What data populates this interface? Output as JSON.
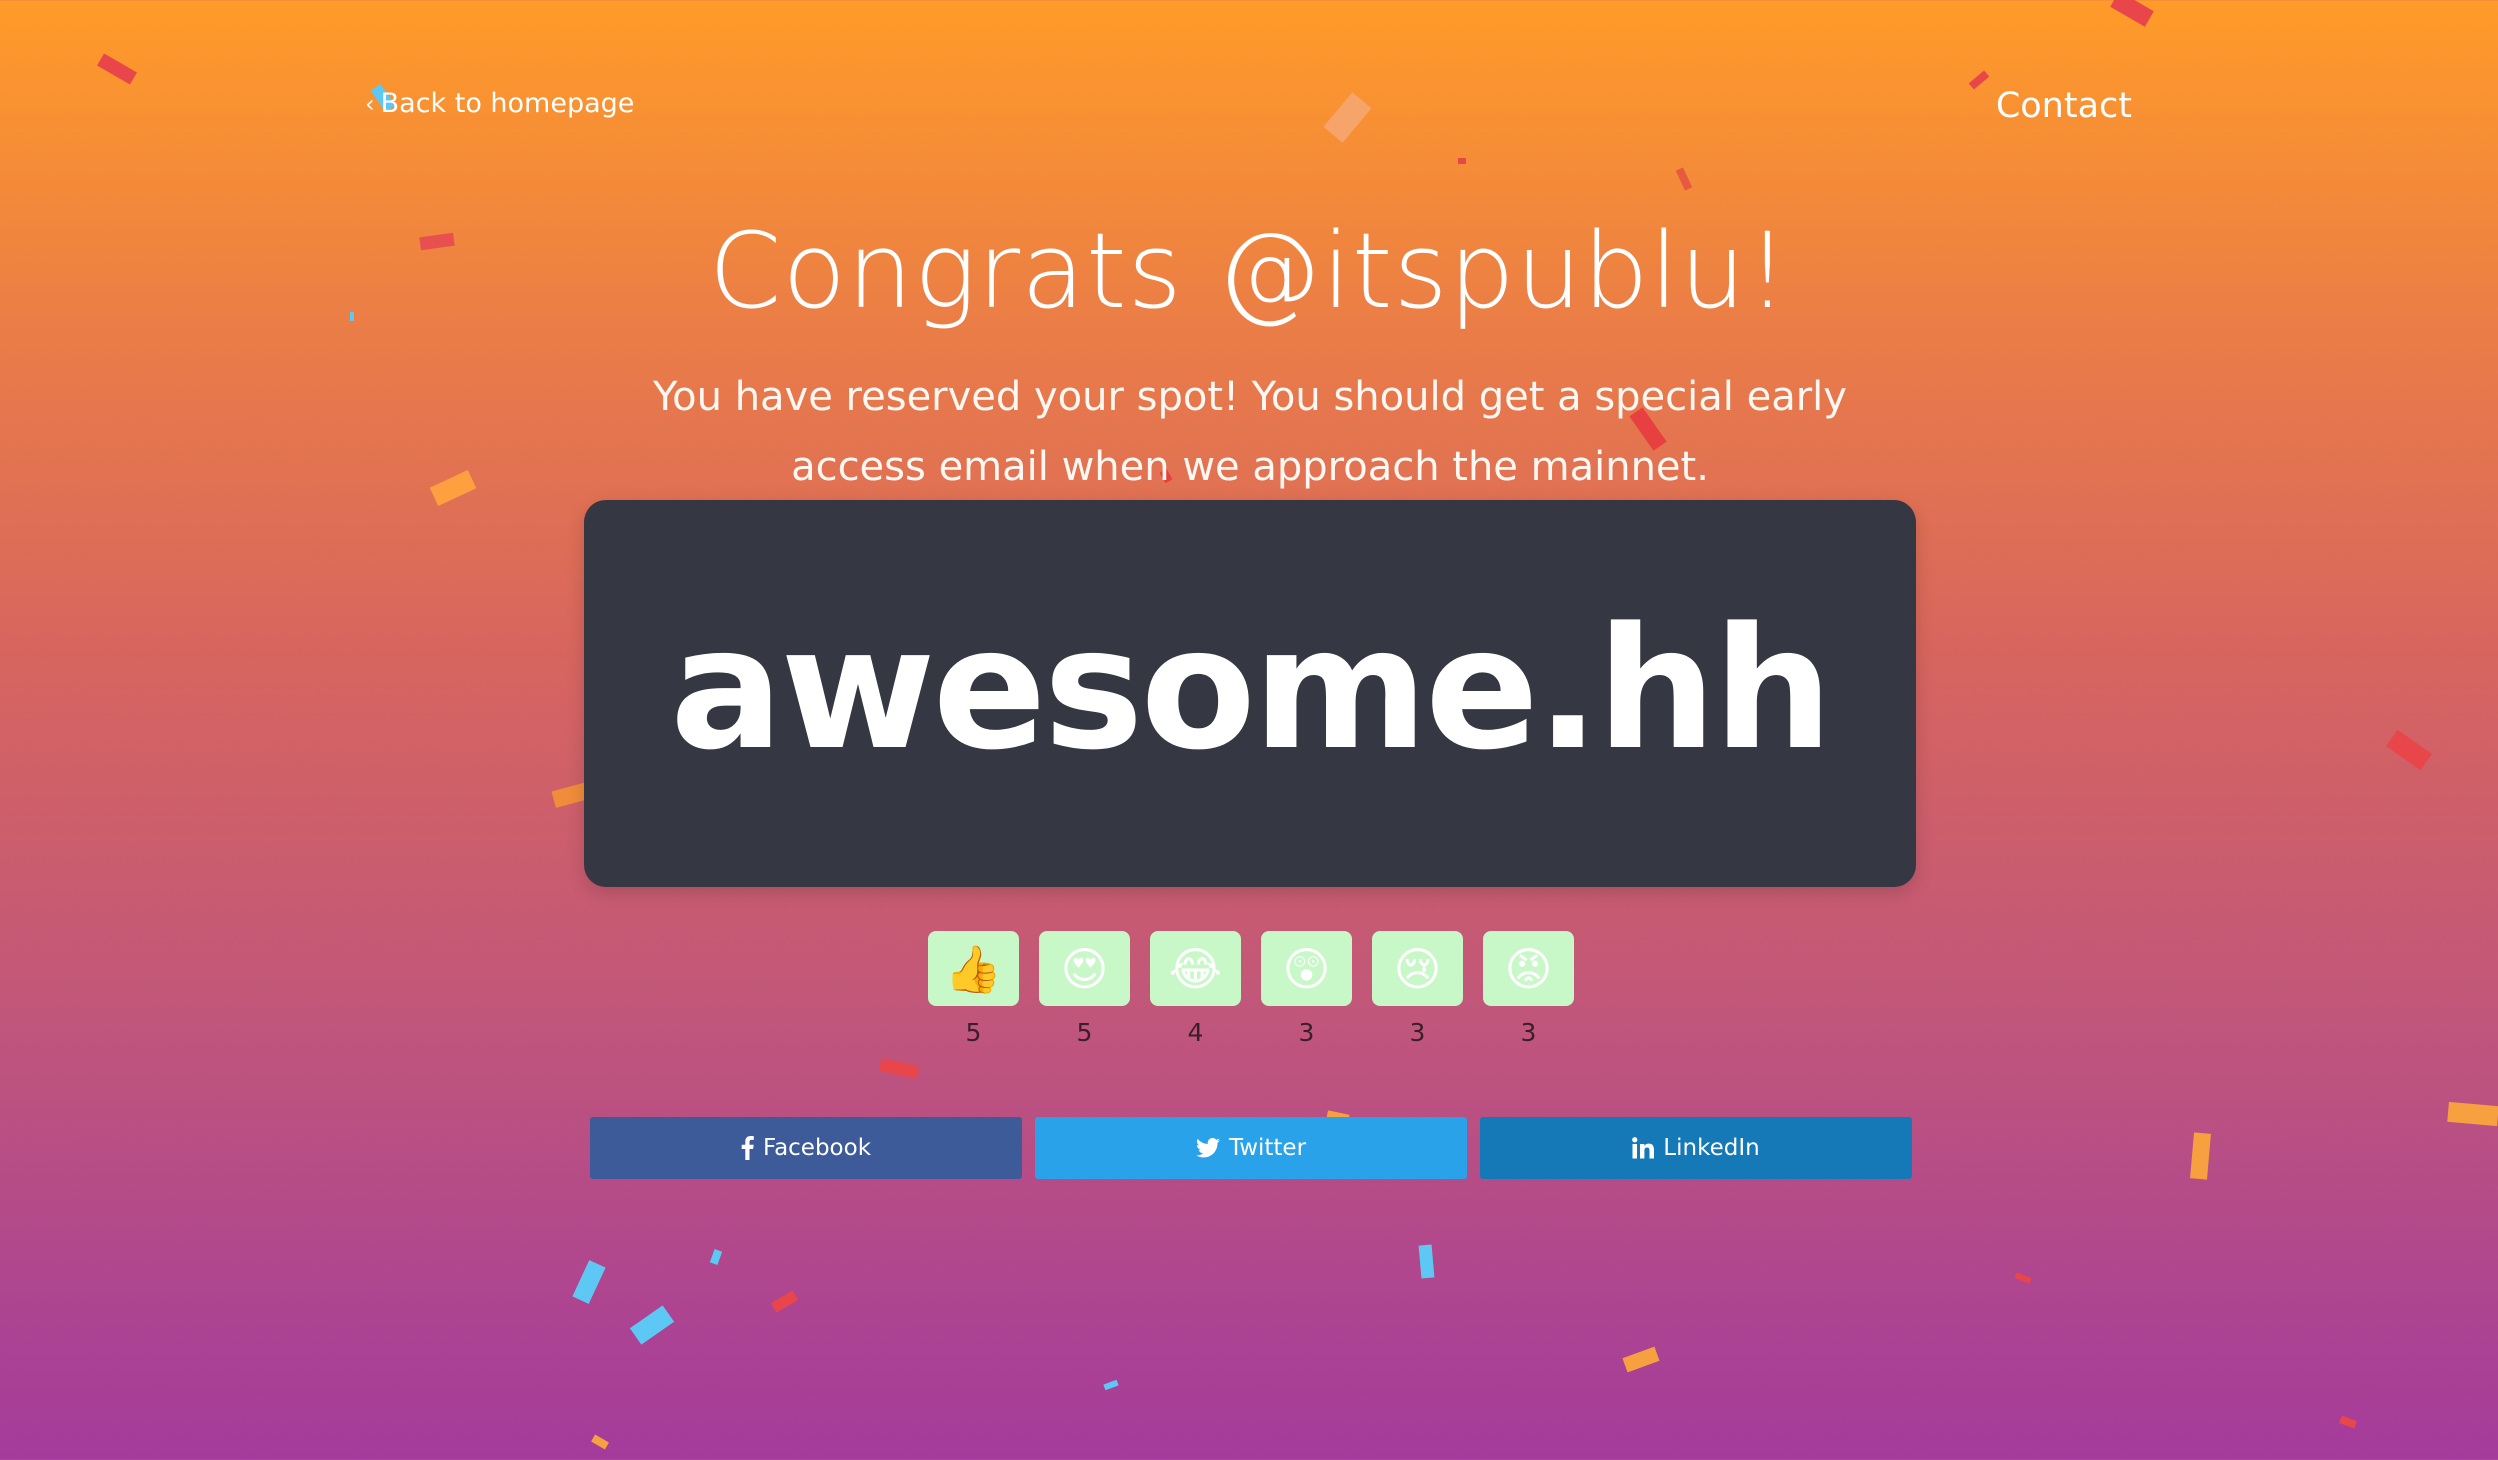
{
  "nav": {
    "back_label": "Back to homepage",
    "contact_label": "Contact"
  },
  "hero": {
    "title": "Congrats @itspublu!",
    "subtitle": "You have reserved your spot! You should get a special early access email when we approach the mainnet."
  },
  "card": {
    "name": "awesome.hh"
  },
  "reactions": [
    {
      "emoji": "👍",
      "icon": "thumbs-up-icon",
      "count": "5"
    },
    {
      "emoji": "😍",
      "icon": "heart-eyes-icon",
      "count": "5"
    },
    {
      "emoji": "😂",
      "icon": "tears-of-joy-icon",
      "count": "4"
    },
    {
      "emoji": "😲",
      "icon": "astonished-icon",
      "count": "3"
    },
    {
      "emoji": "😢",
      "icon": "crying-icon",
      "count": "3"
    },
    {
      "emoji": "😡",
      "icon": "angry-icon",
      "count": "3"
    }
  ],
  "share": {
    "facebook_label": "Facebook",
    "twitter_label": "Twitter",
    "linkedin_label": "LinkedIn"
  },
  "colors": {
    "gradient_top": "#ff9b28",
    "gradient_bottom": "#a43b9c",
    "card_bg": "#353842",
    "reaction_bg": "#c8f7c8",
    "facebook": "#3d5b98",
    "twitter": "#2aa2ea",
    "linkedin": "#1479b6"
  }
}
